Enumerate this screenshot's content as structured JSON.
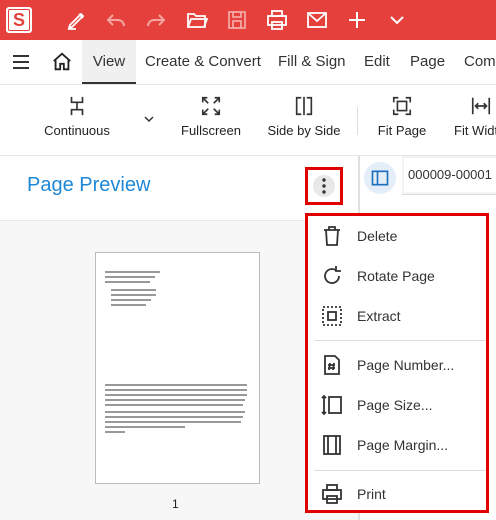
{
  "titlebar": {
    "app_logo": "S"
  },
  "menubar": {
    "items": [
      "View",
      "Create & Convert",
      "Fill & Sign",
      "Edit",
      "Page",
      "Com"
    ]
  },
  "toolbar": {
    "continuous": "Continuous",
    "fullscreen": "Fullscreen",
    "side_by_side": "Side by Side",
    "fit_page": "Fit Page",
    "fit_width": "Fit Widt"
  },
  "panel": {
    "title": "Page Preview",
    "page_number": "1"
  },
  "document_tab": {
    "label": "000009-00001"
  },
  "context_menu": {
    "items": [
      "Delete",
      "Rotate Page",
      "Extract",
      "Page Number...",
      "Page Size...",
      "Page Margin...",
      "Print"
    ]
  },
  "colors": {
    "brand": "#e5403b",
    "accent": "#1e88d6",
    "highlight": "#e00000"
  }
}
